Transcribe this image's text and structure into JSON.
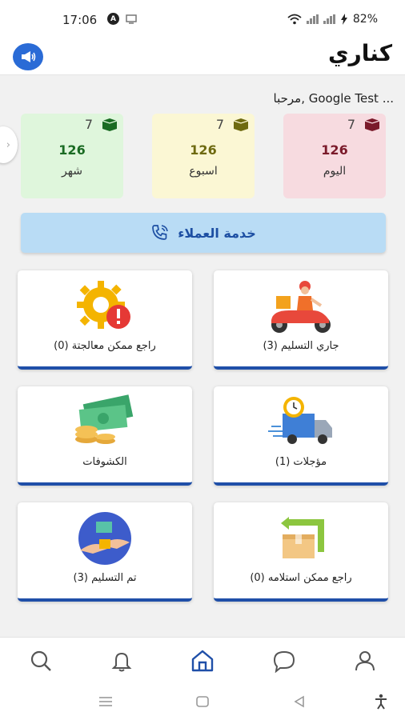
{
  "status_bar": {
    "time": "17:06",
    "battery": "82%"
  },
  "header": {
    "title": "كناري",
    "speaker_icon": "megaphone-icon"
  },
  "greeting": "مرحبا, Google Test ...",
  "stats": [
    {
      "key": "today",
      "label": "اليوم",
      "value": "126",
      "count": "7",
      "bg": "#f7dbe0",
      "accent": "#7a1a2a"
    },
    {
      "key": "week",
      "label": "اسبوع",
      "value": "126",
      "count": "7",
      "bg": "#fbf7d4",
      "accent": "#6e6a10"
    },
    {
      "key": "month",
      "label": "شهر",
      "value": "126",
      "count": "7",
      "bg": "#dff6dc",
      "accent": "#1a6b23"
    }
  ],
  "customer_service": {
    "label": "خدمة العملاء",
    "icon": "phone-call-icon"
  },
  "tiles": {
    "in_delivery": "جاري التسليم (3)",
    "returns_processing": "راجع ممكن معالجتة (0)",
    "postponed": "مؤجلات (1)",
    "statements": "الكشوفات",
    "returns_receipt": "راجع ممكن استلامه (0)",
    "delivered": "تم التسليم (3)"
  },
  "bottom_nav": [
    "profile-icon",
    "chat-icon",
    "home-icon",
    "bell-icon",
    "search-icon"
  ],
  "colors": {
    "primary": "#1f4fa8",
    "cs_bg": "#b9dcf5"
  }
}
